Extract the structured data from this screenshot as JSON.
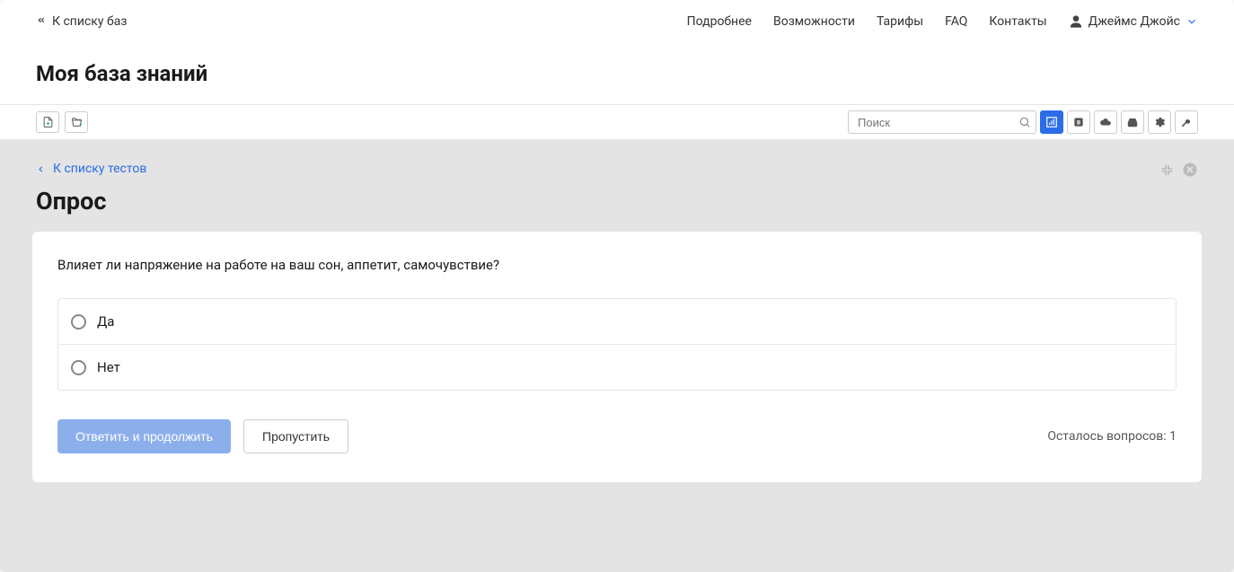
{
  "header": {
    "back_to_bases": "К списку баз",
    "nav": {
      "more": "Подробнее",
      "features": "Возможности",
      "tariffs": "Тарифы",
      "faq": "FAQ",
      "contacts": "Контакты"
    },
    "user_name": "Джеймс Джойс"
  },
  "kb_title": "Моя база знаний",
  "toolbar": {
    "search_placeholder": "Поиск"
  },
  "content": {
    "back_to_tests": "К списку тестов",
    "survey_title": "Опрос",
    "question": "Влияет ли напряжение на работе на ваш сон, аппетит, самочувствие?",
    "options": [
      "Да",
      "Нет"
    ],
    "answer_btn": "Ответить и продолжить",
    "skip_btn": "Пропустить",
    "questions_left": "Осталось вопросов: 1"
  }
}
